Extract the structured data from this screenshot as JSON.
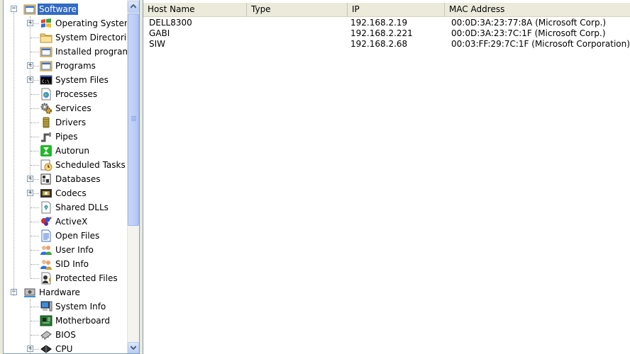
{
  "tree": {
    "software": {
      "label": "Software",
      "expander": "⊟"
    },
    "software_items": [
      {
        "name": "operating-system",
        "label": "Operating System",
        "icon": "windows-flag-icon",
        "expandable": true
      },
      {
        "name": "system-directories",
        "label": "System Directories",
        "icon": "folder-icon",
        "expandable": false
      },
      {
        "name": "installed-programs",
        "label": "Installed programs",
        "icon": "window-icon",
        "expandable": false
      },
      {
        "name": "programs",
        "label": "Programs",
        "icon": "window-icon",
        "expandable": true
      },
      {
        "name": "system-files",
        "label": "System Files",
        "icon": "console-icon",
        "expandable": true
      },
      {
        "name": "processes",
        "label": "Processes",
        "icon": "process-icon",
        "expandable": false
      },
      {
        "name": "services",
        "label": "Services",
        "icon": "gears-icon",
        "expandable": false
      },
      {
        "name": "drivers",
        "label": "Drivers",
        "icon": "driver-icon",
        "expandable": false
      },
      {
        "name": "pipes",
        "label": "Pipes",
        "icon": "pipe-icon",
        "expandable": false
      },
      {
        "name": "autorun",
        "label": "Autorun",
        "icon": "hourglass-icon",
        "expandable": false
      },
      {
        "name": "scheduled-tasks",
        "label": "Scheduled Tasks",
        "icon": "clock-icon",
        "expandable": false
      },
      {
        "name": "databases",
        "label": "Databases",
        "icon": "database-icon",
        "expandable": true
      },
      {
        "name": "codecs",
        "label": "Codecs",
        "icon": "film-icon",
        "expandable": true
      },
      {
        "name": "shared-dlls",
        "label": "Shared DLLs",
        "icon": "dll-icon",
        "expandable": false
      },
      {
        "name": "activex",
        "label": "ActiveX",
        "icon": "activex-icon",
        "expandable": false
      },
      {
        "name": "open-files",
        "label": "Open Files",
        "icon": "document-icon",
        "expandable": false
      },
      {
        "name": "user-info",
        "label": "User Info",
        "icon": "users-icon",
        "expandable": false
      },
      {
        "name": "sid-info",
        "label": "SID Info",
        "icon": "sid-users-icon",
        "expandable": false
      },
      {
        "name": "protected-files",
        "label": "Protected Files",
        "icon": "protected-icon",
        "expandable": false
      }
    ],
    "hardware": {
      "label": "Hardware",
      "expander": "⊟"
    },
    "hardware_items": [
      {
        "name": "system-info",
        "label": "System Info",
        "icon": "computer-icon",
        "expandable": false
      },
      {
        "name": "motherboard",
        "label": "Motherboard",
        "icon": "board-icon",
        "expandable": false
      },
      {
        "name": "bios",
        "label": "BIOS",
        "icon": "chip-icon",
        "expandable": false
      },
      {
        "name": "cpu",
        "label": "CPU",
        "icon": "cpu-icon",
        "expandable": true
      }
    ]
  },
  "list": {
    "columns": [
      "Host Name",
      "Type",
      "IP",
      "MAC Address"
    ],
    "rows": [
      {
        "host": "DELL8300",
        "type": "",
        "ip": "192.168.2.19",
        "mac": "00:0D:3A:23:77:8A (Microsoft Corp.)"
      },
      {
        "host": "GABI",
        "type": "",
        "ip": "192.168.2.221",
        "mac": "00:0D:3A:23:7C:1F (Microsoft Corp.)"
      },
      {
        "host": "SIW",
        "type": "",
        "ip": "192.168.2.68",
        "mac": "00:03:FF:29:7C:1F (Microsoft Corporation)"
      }
    ]
  },
  "colors": {
    "selection": "#316ac5",
    "header_bg": "#ebeadb",
    "tree_border": "#7f9db9",
    "window_bg": "#ece9d8"
  }
}
